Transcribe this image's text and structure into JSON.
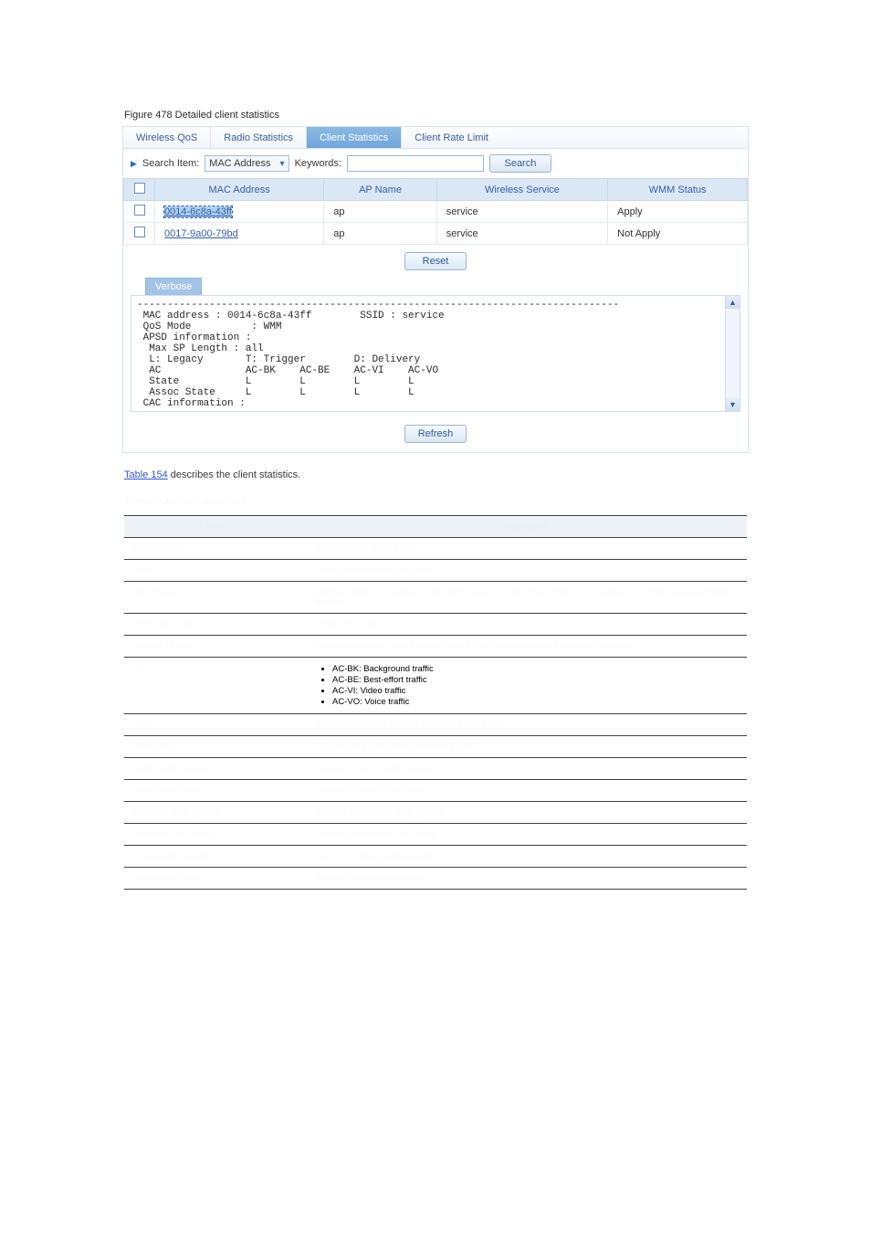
{
  "figure_label": "Figure 478 Detailed client statistics",
  "tabs": [
    {
      "label": "Wireless QoS",
      "active": false
    },
    {
      "label": "Radio Statistics",
      "active": false
    },
    {
      "label": "Client Statistics",
      "active": true
    },
    {
      "label": "Client Rate Limit",
      "active": false
    }
  ],
  "search": {
    "label_left": "Search Item:",
    "select_value": "MAC Address",
    "keywords_label": "Keywords:",
    "keywords_value": "",
    "button": "Search"
  },
  "data_table": {
    "headers": [
      "",
      "MAC Address",
      "AP Name",
      "Wireless Service",
      "WMM Status"
    ],
    "rows": [
      {
        "mac": "0014-6c8a-43ff",
        "ap": "ap",
        "svc": "service",
        "wmm": "Apply",
        "selected": true
      },
      {
        "mac": "0017-9a00-79bd",
        "ap": "ap",
        "svc": "service",
        "wmm": "Not Apply",
        "selected": false
      }
    ]
  },
  "buttons": {
    "reset": "Reset",
    "refresh": "Refresh"
  },
  "verbose_tab": "Verbose",
  "verbose_text": "--------------------------------------------------------------------------------\n MAC address : 0014-6c8a-43ff        SSID : service\n QoS Mode          : WMM\n APSD information :\n  Max SP Length : all\n  L: Legacy       T: Trigger        D: Delivery\n  AC              AC-BK    AC-BE    AC-VI    AC-VO\n  State           L        L        L        L\n  Assoc State     L        L        L        L\n CAC information :\n",
  "caption_tableref": {
    "prefix": "",
    "link": "Table 154",
    "suffix": " describes the client statistics."
  },
  "table_title": "Table 154 Client statistics",
  "desc_table": {
    "header": {
      "field": "Field",
      "desc": "Description"
    },
    "rows": [
      {
        "f": "MAC address",
        "d": "MAC address of the client"
      },
      {
        "f": "SSID",
        "d": "SSID associated with the client"
      },
      {
        "f": "QoS Mode",
        "d": "Whether WMM is enabled on the client. None indicates that WMM is not enabled and WMM indicates WMM is enabled."
      },
      {
        "f": "APSD information",
        "d": "APSD information"
      },
      {
        "f": "Max SP Length",
        "d": "Maximum number of data packets that the AP can send when the client is triggered"
      },
      {
        "f": "AC",
        "d_list": [
          "AC-BK: Background traffic",
          "AC-BE: Best-effort traffic",
          "AC-VI: Video traffic",
          "AC-VO: Voice traffic"
        ]
      },
      {
        "f": "State",
        "d": "AC state when the client is associated with the AP"
      },
      {
        "f": "Assoc State",
        "d": "AC state when the client accesses the AP"
      },
      {
        "f": "Uplink CAC packets",
        "d": "Number of uplink CAC packets"
      },
      {
        "f": "Uplink CAC bytes",
        "d": "Number of uplink CAC bytes"
      },
      {
        "f": "Downlink CAC packets",
        "d": "Number of downlink CAC packets"
      },
      {
        "f": "Downlink CAC bytes",
        "d": "Number of downlink CAC bytes"
      },
      {
        "f": "Downgrade packets",
        "d": "Number of downgrade packets"
      },
      {
        "f": "Downgrade bytes",
        "d": "Number of downgrade bytes"
      }
    ]
  }
}
